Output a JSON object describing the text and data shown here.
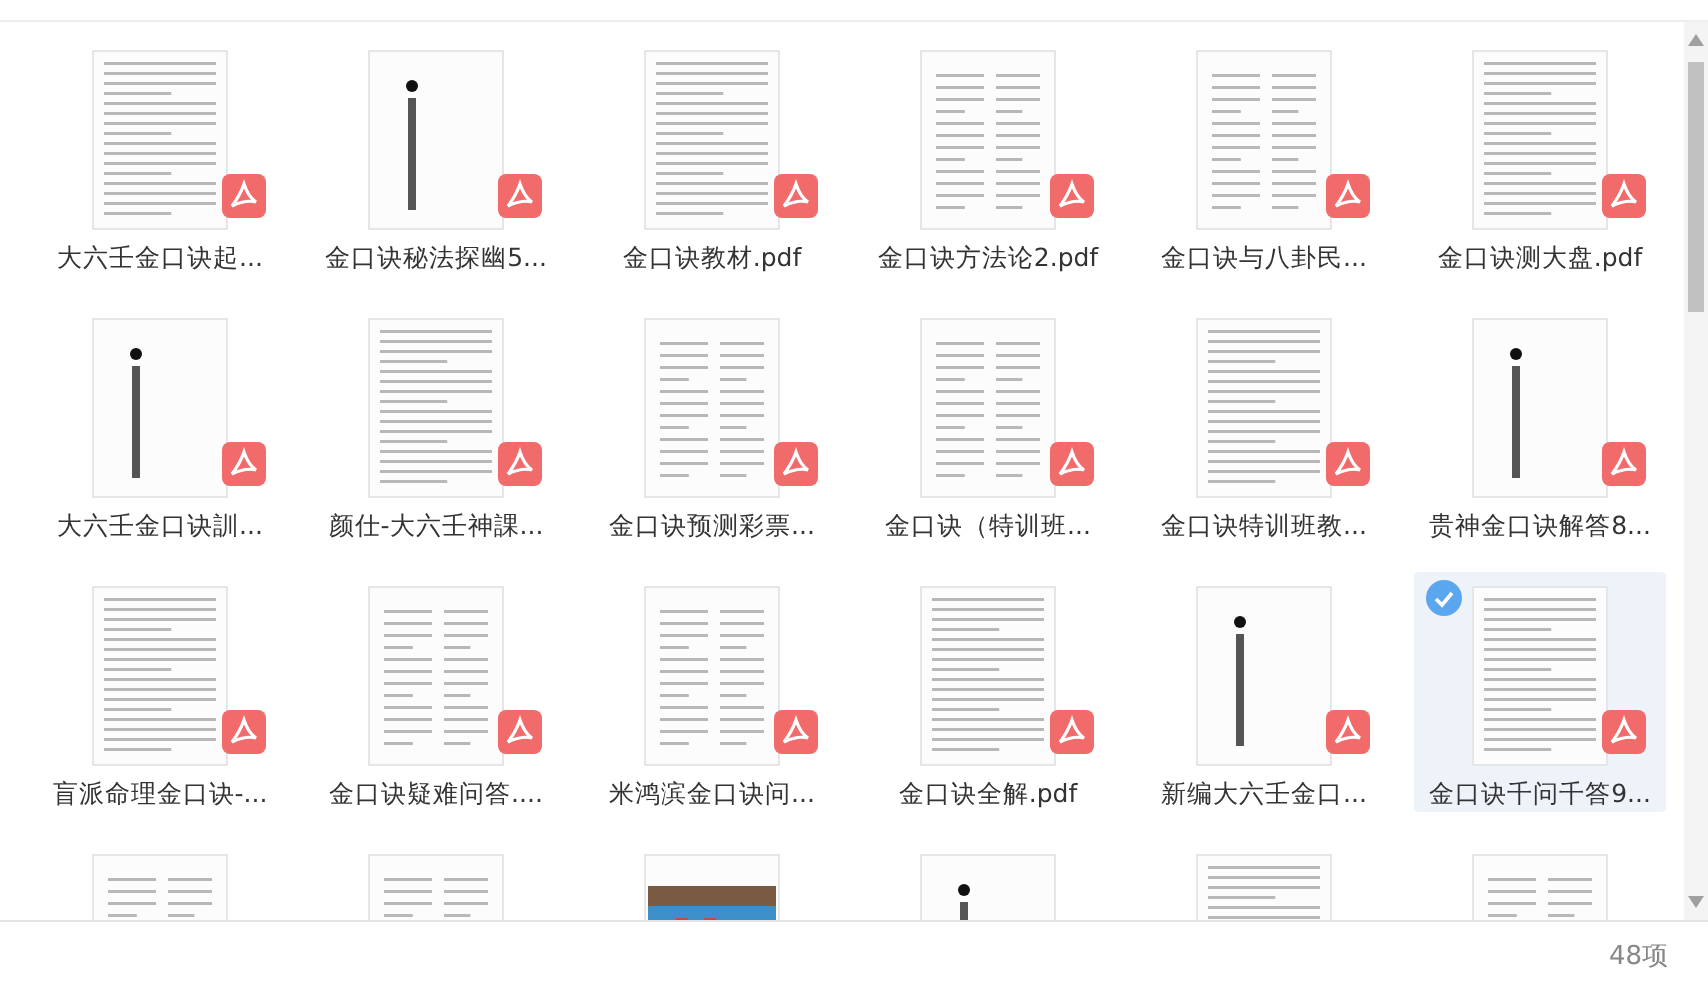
{
  "files": [
    {
      "label": "大六壬金口诀起...",
      "selected": false
    },
    {
      "label": "金口诀秘法探幽5...",
      "selected": false
    },
    {
      "label": "金口诀教材.pdf",
      "selected": false
    },
    {
      "label": "金口诀方法论2.pdf",
      "selected": false
    },
    {
      "label": "金口诀与八卦民...",
      "selected": false
    },
    {
      "label": "金口诀测大盘.pdf",
      "selected": false
    },
    {
      "label": "大六壬金口诀訓...",
      "selected": false
    },
    {
      "label": "颜仕-大六壬神課...",
      "selected": false
    },
    {
      "label": "金口诀预测彩票...",
      "selected": false
    },
    {
      "label": "金口诀（特训班...",
      "selected": false
    },
    {
      "label": "金口诀特训班教...",
      "selected": false
    },
    {
      "label": "贵神金口诀解答8...",
      "selected": false
    },
    {
      "label": "盲派命理金口诀-...",
      "selected": false
    },
    {
      "label": "金口诀疑难问答....",
      "selected": false
    },
    {
      "label": "米鸿滨金口诀问...",
      "selected": false
    },
    {
      "label": "金口诀全解.pdf",
      "selected": false
    },
    {
      "label": "新编大六壬金口...",
      "selected": false
    },
    {
      "label": "金口诀千问千答9...",
      "selected": true
    },
    {
      "selected": false
    },
    {
      "selected": false
    },
    {
      "selected": false
    },
    {
      "selected": false
    },
    {
      "selected": false
    },
    {
      "selected": false
    }
  ],
  "status_bar": {
    "count": "48项"
  }
}
